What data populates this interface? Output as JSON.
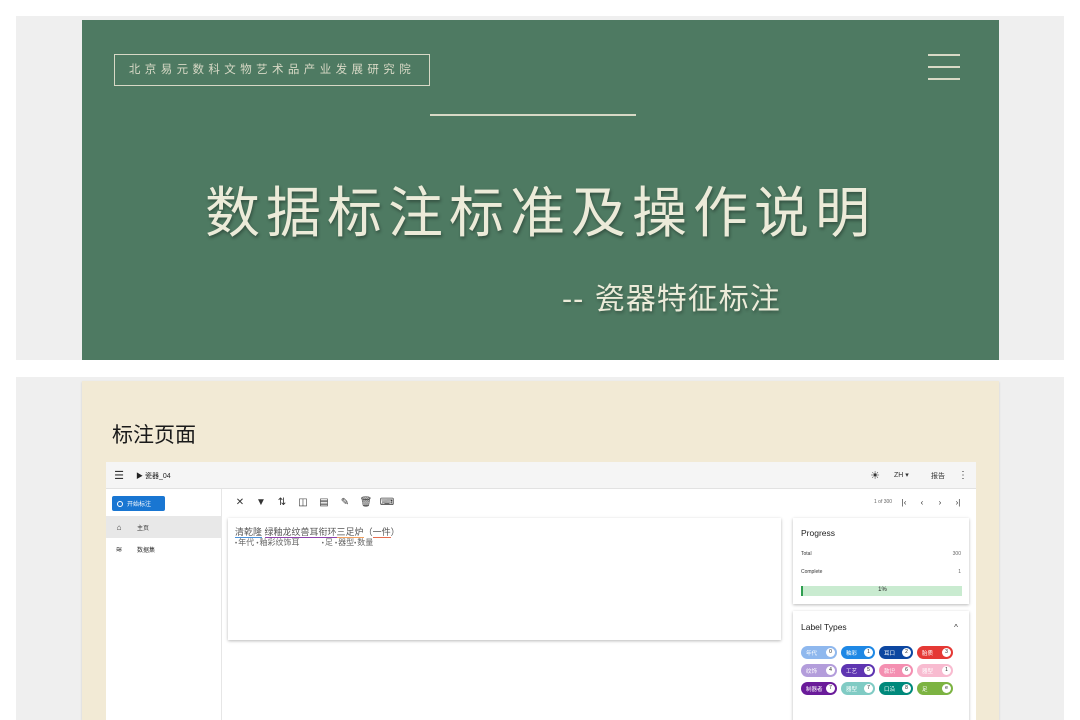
{
  "slide1": {
    "org_name": "北京易元数科文物艺术品产业发展研究院",
    "title": "数据标注标准及操作说明",
    "subtitle": "-- 瓷器特征标注"
  },
  "slide2": {
    "heading": "标注页面",
    "app": {
      "doc_title": "瓷器_04",
      "language": "ZH",
      "report_label": "报告",
      "sidebar": {
        "start_button": "开始标注",
        "items": [
          {
            "label": "主页",
            "icon": "home-icon"
          },
          {
            "label": "数据集",
            "icon": "database-icon"
          }
        ]
      },
      "toolbar": {
        "tools": [
          "close-icon",
          "filter-icon",
          "sort-icon",
          "split-view-icon",
          "comment-icon",
          "auto-label-icon",
          "delete-icon",
          "keyboard-icon"
        ]
      },
      "pager": {
        "text": "1 of 300"
      },
      "document": {
        "line1": [
          "清乾隆",
          " ",
          "绿釉龙纹兽耳衔环",
          "三足炉",
          "（",
          "一件",
          "）"
        ],
        "line2": [
          {
            "tag": "年代",
            "pad": ""
          },
          {
            "tag": "釉彩纹饰耳",
            "pad": "         "
          },
          {
            "tag": "足",
            "pad": ""
          },
          {
            "tag": "器型",
            "pad": ""
          },
          {
            "tag": "数量",
            "pad": ""
          }
        ]
      },
      "progress": {
        "title": "Progress",
        "total_label": "Total",
        "total_value": "300",
        "complete_label": "Complete",
        "complete_value": "1",
        "percent_label": "1%",
        "percent": 1
      },
      "label_types": {
        "title": "Label Types",
        "labels": [
          {
            "name": "年代",
            "count": "0",
            "color": "#8fb8ee"
          },
          {
            "name": "釉彩",
            "count": "1",
            "color": "#1e88e5"
          },
          {
            "name": "耳口",
            "count": "2",
            "color": "#0d47a1"
          },
          {
            "name": "胎质",
            "count": "3",
            "color": "#e53935"
          },
          {
            "name": "纹饰",
            "count": "4",
            "color": "#b39ddb"
          },
          {
            "name": "工艺",
            "count": "5",
            "color": "#5e35b1"
          },
          {
            "name": "款识",
            "count": "6",
            "color": "#f48fb1"
          },
          {
            "name": "器型",
            "count": "1",
            "color": "#f8bbd0"
          },
          {
            "name": "制器者",
            "count": "7",
            "color": "#6a1b9a"
          },
          {
            "name": "器型",
            "count": "7",
            "color": "#80cbc4"
          },
          {
            "name": "口沿",
            "count": "8",
            "color": "#00897b"
          },
          {
            "name": "足",
            "count": "e",
            "color": "#7cb342"
          }
        ]
      }
    }
  }
}
